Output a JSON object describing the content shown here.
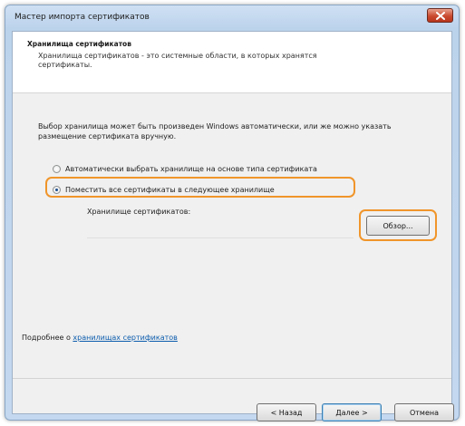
{
  "window": {
    "title": "Мастер импорта сертификатов"
  },
  "header": {
    "title": "Хранилища сертификатов",
    "description": "Хранилища сертификатов - это системные области, в которых хранятся сертификаты."
  },
  "main": {
    "intro_text": "Выбор хранилища может быть произведен Windows автоматически, или же можно указать размещение сертификата вручную.",
    "radio_auto_label": "Автоматически выбрать хранилище на основе типа сертификата",
    "radio_manual_label": "Поместить все сертификаты в следующее хранилище",
    "selected_option": "manual",
    "store_label": "Хранилище сертификатов:",
    "store_value": "",
    "browse_label": "Обзор..."
  },
  "footer": {
    "more_info_prefix": "Подробнее о ",
    "more_info_link": "хранилищах сертификатов",
    "back_label": "< Назад",
    "next_label": "Далее >",
    "cancel_label": "Отмена"
  },
  "colors": {
    "highlight": "#f0952a",
    "link": "#0b5cad",
    "close_button": "#c94a2f"
  },
  "icons": {
    "close": "close-icon"
  }
}
